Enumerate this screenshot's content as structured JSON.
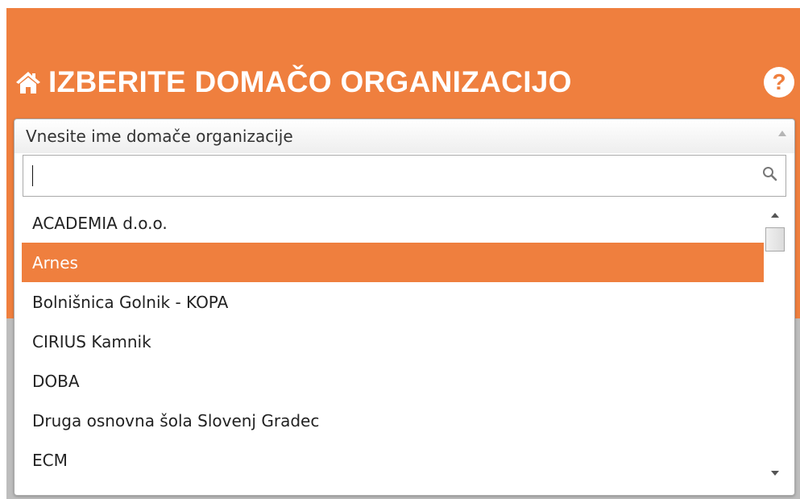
{
  "header": {
    "title": "IZBERITE DOMAČO ORGANIZACIJO",
    "home_icon": "home-icon",
    "help_icon": "question-circle-icon",
    "help_glyph": "?"
  },
  "colors": {
    "accent": "#ef7f3e",
    "background_lower": "#bdbdbd",
    "highlight_text": "#ffffff"
  },
  "dropdown": {
    "label": "Vnesite ime domače organizacije",
    "search": {
      "value": "",
      "placeholder": "",
      "icon": "search-icon"
    },
    "selected_index": 1,
    "options": [
      "ACADEMIA d.o.o.",
      "Arnes",
      "Bolnišnica Golnik - KOPA",
      "CIRIUS Kamnik",
      "DOBA",
      "Druga osnovna šola Slovenj Gradec",
      "ECM"
    ]
  }
}
